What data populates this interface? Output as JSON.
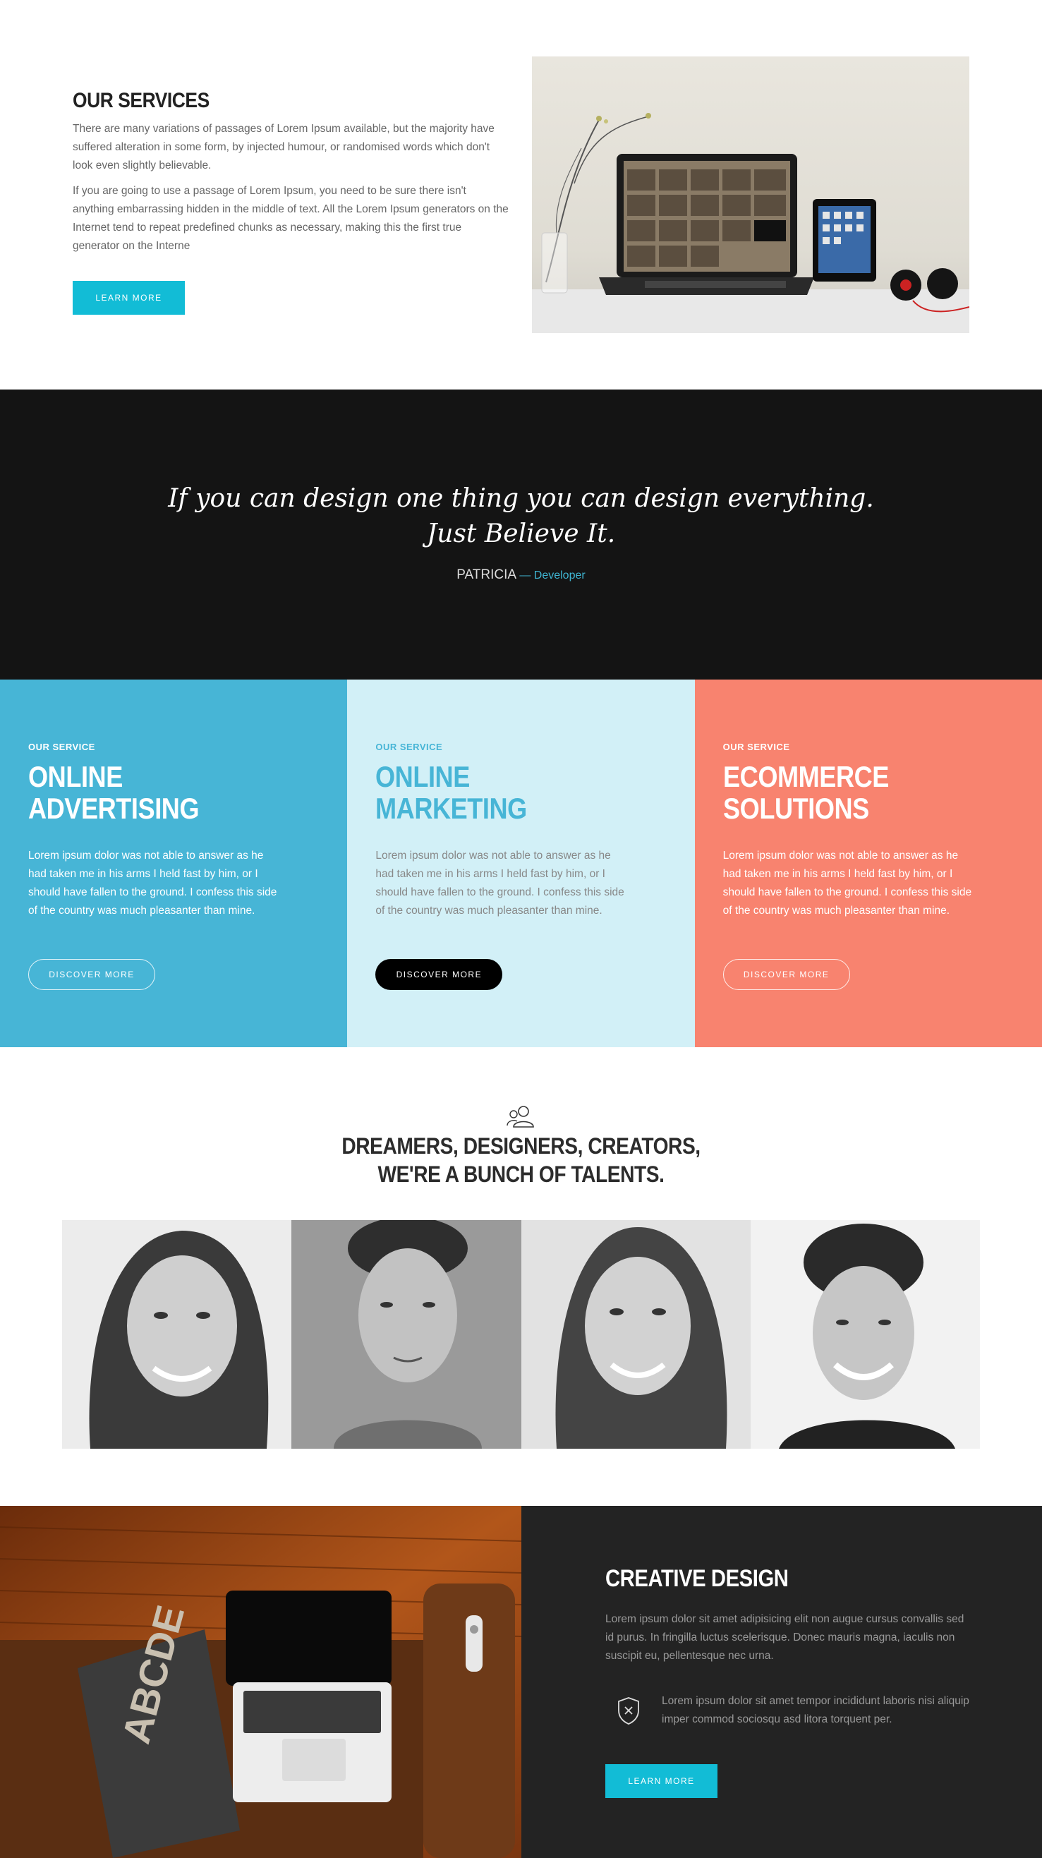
{
  "services": {
    "title": "OUR SERVICES",
    "paragraph_1": "There are many variations of passages of Lorem Ipsum available, but the majority have suffered alteration in some form, by injected humour, or randomised words which don't look even slightly believable.",
    "paragraph_2": "If you are going to use a passage of Lorem Ipsum, you need to be sure there isn't anything embarrassing hidden in the middle of text. All the Lorem Ipsum generators on the Internet tend to repeat predefined chunks as necessary, making this the first true generator on the Interne",
    "button_label": "LEARN MORE"
  },
  "quote": {
    "line_1": "If you can design one thing you can design everything.",
    "line_2": "Just Believe It.",
    "author": "PATRICIA",
    "role": "— Developer"
  },
  "columns": [
    {
      "eyebrow": "OUR SERVICE",
      "title_line_1": "ONLINE",
      "title_line_2": "ADVERTISING",
      "body": "Lorem ipsum dolor was not able to answer as he had taken me in his arms I held fast by him, or I should have fallen to the ground. I confess this side of the country was much pleasanter than mine.",
      "button_label": "DISCOVER MORE",
      "color": "#47b5d6"
    },
    {
      "eyebrow": "OUR SERVICE",
      "title_line_1": "ONLINE",
      "title_line_2": "MARKETING",
      "body": "Lorem ipsum dolor was not able to answer as he had taken me in his arms I held fast by him, or I should have fallen to the ground. I confess this side of the country was much pleasanter than mine.",
      "button_label": "DISCOVER MORE",
      "color": "#d2f0f7"
    },
    {
      "eyebrow": "OUR SERVICE",
      "title_line_1": "ECOMMERCE",
      "title_line_2": "SOLUTIONS",
      "body": "Lorem ipsum dolor was not able to answer as he had taken me in his arms I held fast by him, or I should have fallen to the ground. I confess this side of the country was much pleasanter than mine.",
      "button_label": "DISCOVER MORE",
      "color": "#f8836f"
    }
  ],
  "team": {
    "icon": "users-icon",
    "title_line_1": "DREAMERS, DESIGNERS, CREATORS,",
    "title_line_2": "WE'RE A BUNCH OF TALENTS."
  },
  "creative": {
    "title": "CREATIVE DESIGN",
    "intro": "Lorem ipsum dolor sit amet adipisicing elit non augue cursus convallis sed id purus. In fringilla luctus scelerisque. Donec mauris magna, iaculis non suscipit eu, pellentesque nec urna.",
    "feature_icon": "shield-x-icon",
    "feature_text": "Lorem ipsum dolor sit amet tempor incididunt laboris nisi aliquip imper commod sociosqu asd litora torquent per.",
    "button_label": "LEARN MORE"
  },
  "colors": {
    "accent_cyan": "#12bcd6",
    "dark": "#141414",
    "panel_dark": "#232323"
  }
}
